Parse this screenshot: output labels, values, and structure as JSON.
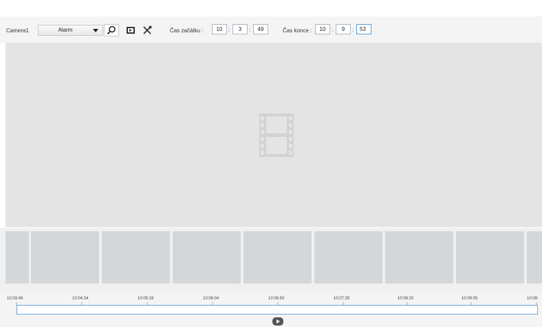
{
  "toolbar": {
    "camera_label": "Camera1",
    "event_type": "Alarm",
    "start_label": "Čas začátku :",
    "end_label": "Čas konce :",
    "start_time": {
      "h": "10",
      "m": "3",
      "s": "49"
    },
    "end_time": {
      "h": "10",
      "m": "9",
      "s": "53"
    },
    "colon": ":",
    "search_icon": "search-icon",
    "export_icon": "video-export-icon",
    "tools_icon": "tools-icon"
  },
  "viewer": {
    "placeholder_icon": "film-strip-icon",
    "background": "#e4e4e4"
  },
  "thumbnails": {
    "count": 8
  },
  "timeline": {
    "ticks": [
      "10:03:49",
      "10:04:34",
      "10:05:19",
      "10:06:04",
      "10:06:50",
      "10:07:35",
      "10:08:20",
      "10:09:05",
      "10:09:"
    ],
    "play_icon": "play-icon",
    "accent": "#6aa3d8"
  }
}
